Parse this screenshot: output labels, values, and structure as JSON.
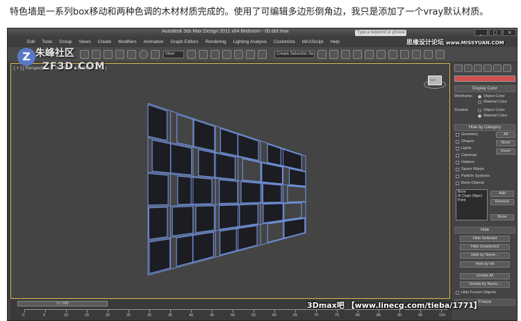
{
  "caption": "特色墙是一系列box移动和两种色调的木材材质完成的。使用了可编辑多边形倒角边，我只是添加了一个vray默认材质。",
  "app": {
    "title": "Autodesk 3ds Max Design 2011 x64    Bedroom - 00.dof.max",
    "search_placeholder": "Type a keyword or phrase",
    "menu": [
      "Edit",
      "Tools",
      "Group",
      "Views",
      "Create",
      "Modifiers",
      "Animation",
      "Graph Editors",
      "Rendering",
      "Lighting Analysis",
      "Customize",
      "MAXScript",
      "Help"
    ],
    "toolbar": {
      "view_dropdown": "View",
      "selection_set": "Create Selection Se"
    },
    "viewport_label": "[ + ] [ Perspective ] [ Realistic + Edged Faces ]",
    "viewcube_label": "TOP"
  },
  "watermarks": {
    "logo_letter": "Z",
    "site_name_cn": "朱峰社区",
    "site_domain": "ZF3D.COM",
    "top_right_cn": "思缘设计论坛",
    "top_right_url": "www.MISSYUAN.COM",
    "bottom": "3Dmax吧 【www.linecg.com/tieba/1771】"
  },
  "command_panel": {
    "display_color": {
      "title": "Display Color",
      "wireframe_label": "Wireframe:",
      "shaded_label": "Shaded:",
      "object_color": "Object Color",
      "material_color": "Material Color"
    },
    "hide_by_category": {
      "title": "Hide by Category",
      "items": [
        "Geometry",
        "Shapes",
        "Lights",
        "Cameras",
        "Helpers",
        "Space Warps",
        "Particle Systems",
        "Bone Objects"
      ],
      "btn_all": "All",
      "btn_none": "None",
      "btn_invert": "Invert",
      "list_items": [
        "Bone",
        "IK Chain Object",
        "Point"
      ],
      "btn_add": "Add",
      "btn_remove": "Remove",
      "btn_none2": "None"
    },
    "hide": {
      "title": "Hide",
      "buttons": [
        "Hide Selected",
        "Hide Unselected",
        "Hide by Name...",
        "Hide by Hit",
        "Unhide All",
        "Unhide by Name...",
        "Hide Frozen Objects"
      ]
    },
    "freeze": {
      "title": "Freeze"
    }
  },
  "timeline": {
    "slider": "0 / 100",
    "ticks": [
      "0",
      "5",
      "10",
      "15",
      "20",
      "25",
      "30",
      "35",
      "40",
      "45",
      "50",
      "55",
      "60",
      "65",
      "70",
      "75",
      "80",
      "85",
      "90",
      "95",
      "100"
    ]
  },
  "colors": {
    "viewport_bg": "#444444",
    "wire_color": "#6f8fd8",
    "panel_dark": "#1c1d22",
    "wood_light": "#d9b07a"
  }
}
